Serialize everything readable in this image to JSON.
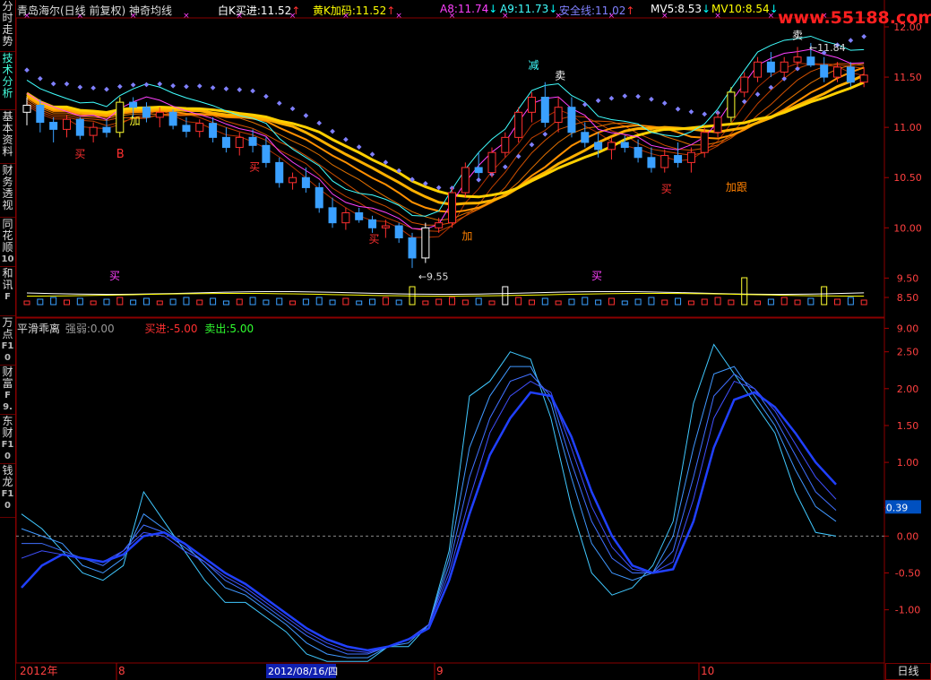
{
  "sidebar": [
    {
      "label": "分时走势",
      "sub": "",
      "active": false
    },
    {
      "label": "技术分析",
      "sub": "",
      "active": true
    },
    {
      "label": "基本资料",
      "sub": "",
      "active": false
    },
    {
      "label": "财务透视",
      "sub": "",
      "active": false
    },
    {
      "label": "同花顺",
      "sub": "10",
      "active": false
    },
    {
      "label": "和讯",
      "sub": "F",
      "active": false
    },
    {
      "label": "万点",
      "sub": "F10",
      "active": false
    },
    {
      "label": "财富",
      "sub": "F9.",
      "active": false
    },
    {
      "label": "东财",
      "sub": "F10",
      "active": false
    },
    {
      "label": "钱龙",
      "sub": "F10",
      "active": false
    }
  ],
  "header": {
    "stock": "青岛海尔(日线 前复权)",
    "indicator": "神奇均线",
    "items": [
      {
        "label": "白K买进:",
        "value": "11.52",
        "arrow": "↑",
        "color": "#ffffff",
        "arrow_color": "#ff3030"
      },
      {
        "label": "黄K加码:",
        "value": "11.52",
        "arrow": "↑",
        "color": "#ffff00",
        "arrow_color": "#ff3030"
      },
      {
        "label": "A8:",
        "value": "11.74",
        "arrow": "↓",
        "color": "#ff40ff",
        "arrow_color": "#00ffff"
      },
      {
        "label": "A9:",
        "value": "11.73",
        "arrow": "↓",
        "color": "#40ffff",
        "arrow_color": "#00ffff"
      },
      {
        "label": "安全线:",
        "value": "11.02",
        "arrow": "↑",
        "color": "#8080ff",
        "arrow_color": "#ff3030"
      },
      {
        "label": "MV5:",
        "value": "8.53",
        "arrow": "↓",
        "color": "#ffffff",
        "arrow_color": "#00ffff"
      },
      {
        "label": "MV10:",
        "value": "8.54",
        "arrow": "↓",
        "color": "#ffff00",
        "arrow_color": "#00ffff"
      }
    ]
  },
  "osc_header": {
    "title": "平滑乖离",
    "strength_label": "强弱:",
    "strength_value": "0.00",
    "buy_label": "买进:",
    "buy_value": "-5.00",
    "sell_label": "卖出:",
    "sell_value": "5.00"
  },
  "watermark": "www.55188.com",
  "price_axis": [
    "12.00",
    "11.50",
    "11.00",
    "10.50",
    "10.00",
    "9.50",
    "9.00",
    "8.50"
  ],
  "osc_axis": [
    "2.50",
    "2.00",
    "1.50",
    "1.00",
    "0.39",
    "0.00",
    "-0.50",
    "-1.00"
  ],
  "osc_current": "0.39",
  "date_axis": {
    "year": "2012年",
    "m8": "8",
    "cursor": "2012/08/16/四",
    "m9": "9",
    "m10": "10"
  },
  "period_label": "日线",
  "annotations": {
    "high_label": "11.84",
    "low_label": "9.55",
    "buy": "买",
    "sell": "卖",
    "add": "加",
    "reduce": "减",
    "b": "B",
    "follow": "加跟"
  },
  "chart_data": {
    "type": "candlestick",
    "price_range": [
      9.2,
      12.0
    ],
    "candles": [
      [
        11.15,
        11.3,
        11.02,
        11.22
      ],
      [
        11.22,
        11.28,
        10.95,
        11.05
      ],
      [
        11.05,
        11.1,
        10.85,
        10.98
      ],
      [
        10.98,
        11.12,
        10.9,
        11.08
      ],
      [
        11.08,
        11.1,
        10.88,
        10.92
      ],
      [
        10.92,
        11.05,
        10.85,
        11.0
      ],
      [
        11.0,
        11.08,
        10.9,
        10.95
      ],
      [
        10.95,
        11.3,
        10.9,
        11.25
      ],
      [
        11.25,
        11.3,
        11.1,
        11.2
      ],
      [
        11.2,
        11.25,
        11.05,
        11.1
      ],
      [
        11.1,
        11.2,
        11.0,
        11.15
      ],
      [
        11.15,
        11.18,
        10.98,
        11.02
      ],
      [
        11.02,
        11.1,
        10.9,
        10.96
      ],
      [
        10.96,
        11.08,
        10.9,
        11.04
      ],
      [
        11.04,
        11.1,
        10.85,
        10.9
      ],
      [
        10.9,
        11.0,
        10.75,
        10.8
      ],
      [
        10.8,
        10.95,
        10.72,
        10.9
      ],
      [
        10.9,
        10.98,
        10.75,
        10.82
      ],
      [
        10.82,
        10.9,
        10.6,
        10.65
      ],
      [
        10.65,
        10.7,
        10.4,
        10.45
      ],
      [
        10.45,
        10.55,
        10.38,
        10.5
      ],
      [
        10.5,
        10.6,
        10.35,
        10.4
      ],
      [
        10.4,
        10.45,
        10.15,
        10.2
      ],
      [
        10.2,
        10.3,
        10.0,
        10.05
      ],
      [
        10.05,
        10.2,
        9.98,
        10.15
      ],
      [
        10.15,
        10.2,
        10.05,
        10.08
      ],
      [
        10.08,
        10.12,
        9.95,
        10.0
      ],
      [
        10.0,
        10.08,
        9.9,
        10.02
      ],
      [
        10.02,
        10.05,
        9.85,
        9.9
      ],
      [
        9.9,
        9.95,
        9.6,
        9.7
      ],
      [
        9.7,
        10.05,
        9.65,
        10.0
      ],
      [
        10.0,
        10.1,
        9.95,
        10.05
      ],
      [
        10.05,
        10.4,
        10.0,
        10.35
      ],
      [
        10.35,
        10.65,
        10.3,
        10.6
      ],
      [
        10.6,
        10.75,
        10.5,
        10.55
      ],
      [
        10.55,
        10.8,
        10.5,
        10.75
      ],
      [
        10.75,
        10.95,
        10.7,
        10.9
      ],
      [
        10.9,
        11.2,
        10.85,
        11.15
      ],
      [
        11.15,
        11.35,
        11.05,
        11.3
      ],
      [
        11.3,
        11.45,
        11.0,
        11.05
      ],
      [
        11.05,
        11.3,
        10.95,
        11.2
      ],
      [
        11.2,
        11.3,
        10.9,
        10.95
      ],
      [
        10.95,
        11.05,
        10.8,
        10.85
      ],
      [
        10.85,
        10.95,
        10.7,
        10.78
      ],
      [
        10.78,
        10.9,
        10.68,
        10.85
      ],
      [
        10.85,
        10.92,
        10.75,
        10.8
      ],
      [
        10.8,
        10.88,
        10.65,
        10.7
      ],
      [
        10.7,
        10.8,
        10.55,
        10.6
      ],
      [
        10.6,
        10.78,
        10.55,
        10.72
      ],
      [
        10.72,
        10.85,
        10.6,
        10.65
      ],
      [
        10.65,
        10.8,
        10.55,
        10.75
      ],
      [
        10.75,
        11.0,
        10.7,
        10.95
      ],
      [
        10.95,
        11.15,
        10.9,
        11.1
      ],
      [
        11.1,
        11.4,
        11.05,
        11.35
      ],
      [
        11.35,
        11.55,
        11.3,
        11.5
      ],
      [
        11.5,
        11.7,
        11.45,
        11.65
      ],
      [
        11.65,
        11.75,
        11.5,
        11.55
      ],
      [
        11.55,
        11.7,
        11.5,
        11.65
      ],
      [
        11.65,
        11.8,
        11.6,
        11.7
      ],
      [
        11.7,
        11.84,
        11.6,
        11.62
      ],
      [
        11.62,
        11.7,
        11.45,
        11.5
      ],
      [
        11.5,
        11.65,
        11.45,
        11.6
      ],
      [
        11.6,
        11.65,
        11.4,
        11.45
      ],
      [
        11.45,
        11.6,
        11.4,
        11.52
      ]
    ],
    "osc_range": [
      -1.6,
      2.8
    ],
    "osc_series": [
      [
        0.3,
        0.1,
        -0.2,
        -0.5,
        -0.6,
        -0.4,
        0.6,
        0.2,
        -0.2,
        -0.6,
        -0.9,
        -0.9,
        -1.1,
        -1.3,
        -1.6,
        -1.7,
        -1.7,
        -1.7,
        -1.5,
        -1.5,
        -1.2,
        -0.2,
        1.9,
        2.1,
        2.5,
        2.4,
        1.6,
        0.4,
        -0.5,
        -0.8,
        -0.7,
        -0.4,
        0.2,
        1.8,
        2.6,
        2.2,
        1.8,
        1.4,
        0.6,
        0.05,
        0.0
      ],
      [
        0.1,
        0.0,
        -0.1,
        -0.4,
        -0.5,
        -0.3,
        0.3,
        0.1,
        -0.1,
        -0.4,
        -0.7,
        -0.8,
        -1.0,
        -1.2,
        -1.45,
        -1.6,
        -1.65,
        -1.65,
        -1.5,
        -1.45,
        -1.2,
        -0.3,
        1.2,
        1.9,
        2.3,
        2.3,
        1.8,
        0.8,
        -0.1,
        -0.5,
        -0.6,
        -0.5,
        0.0,
        1.2,
        2.2,
        2.3,
        1.9,
        1.5,
        0.9,
        0.4,
        0.2
      ],
      [
        -0.1,
        -0.1,
        -0.2,
        -0.3,
        -0.4,
        -0.2,
        0.15,
        0.05,
        -0.15,
        -0.35,
        -0.6,
        -0.75,
        -0.95,
        -1.15,
        -1.35,
        -1.5,
        -1.6,
        -1.6,
        -1.5,
        -1.4,
        -1.2,
        -0.4,
        0.8,
        1.6,
        2.1,
        2.2,
        1.9,
        1.0,
        0.2,
        -0.3,
        -0.5,
        -0.5,
        -0.2,
        0.8,
        1.9,
        2.2,
        2.0,
        1.6,
        1.1,
        0.6,
        0.35
      ],
      [
        -0.3,
        -0.2,
        -0.25,
        -0.3,
        -0.35,
        -0.2,
        0.05,
        0.0,
        -0.2,
        -0.35,
        -0.55,
        -0.7,
        -0.9,
        -1.1,
        -1.3,
        -1.45,
        -1.55,
        -1.58,
        -1.5,
        -1.4,
        -1.2,
        -0.5,
        0.5,
        1.4,
        1.9,
        2.1,
        1.95,
        1.2,
        0.4,
        -0.15,
        -0.45,
        -0.5,
        -0.35,
        0.5,
        1.6,
        2.1,
        2.0,
        1.7,
        1.25,
        0.8,
        0.5
      ],
      [
        -0.7,
        -0.4,
        -0.25,
        -0.3,
        -0.35,
        -0.25,
        0.0,
        0.05,
        -0.1,
        -0.3,
        -0.5,
        -0.65,
        -0.85,
        -1.05,
        -1.25,
        -1.4,
        -1.5,
        -1.55,
        -1.5,
        -1.4,
        -1.25,
        -0.6,
        0.3,
        1.1,
        1.6,
        1.95,
        1.9,
        1.35,
        0.6,
        0.0,
        -0.4,
        -0.5,
        -0.45,
        0.2,
        1.2,
        1.85,
        1.95,
        1.75,
        1.4,
        1.0,
        0.7
      ]
    ]
  }
}
